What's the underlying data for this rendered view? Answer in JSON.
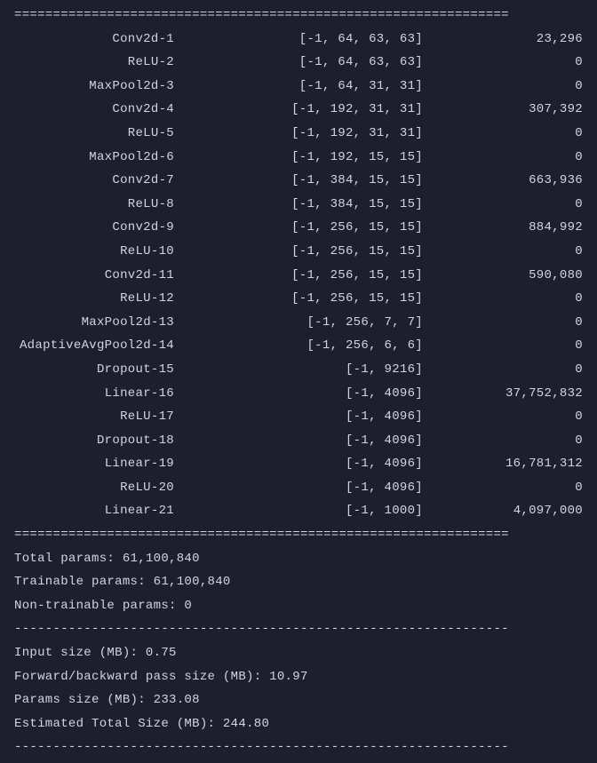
{
  "separator_eq": "================================================================",
  "separator_dash": "----------------------------------------------------------------",
  "layers": [
    {
      "name": "Conv2d-1",
      "shape": "[-1, 64, 63, 63]",
      "params": "23,296"
    },
    {
      "name": "ReLU-2",
      "shape": "[-1, 64, 63, 63]",
      "params": "0"
    },
    {
      "name": "MaxPool2d-3",
      "shape": "[-1, 64, 31, 31]",
      "params": "0"
    },
    {
      "name": "Conv2d-4",
      "shape": "[-1, 192, 31, 31]",
      "params": "307,392"
    },
    {
      "name": "ReLU-5",
      "shape": "[-1, 192, 31, 31]",
      "params": "0"
    },
    {
      "name": "MaxPool2d-6",
      "shape": "[-1, 192, 15, 15]",
      "params": "0"
    },
    {
      "name": "Conv2d-7",
      "shape": "[-1, 384, 15, 15]",
      "params": "663,936"
    },
    {
      "name": "ReLU-8",
      "shape": "[-1, 384, 15, 15]",
      "params": "0"
    },
    {
      "name": "Conv2d-9",
      "shape": "[-1, 256, 15, 15]",
      "params": "884,992"
    },
    {
      "name": "ReLU-10",
      "shape": "[-1, 256, 15, 15]",
      "params": "0"
    },
    {
      "name": "Conv2d-11",
      "shape": "[-1, 256, 15, 15]",
      "params": "590,080"
    },
    {
      "name": "ReLU-12",
      "shape": "[-1, 256, 15, 15]",
      "params": "0"
    },
    {
      "name": "MaxPool2d-13",
      "shape": "[-1, 256, 7, 7]",
      "params": "0"
    },
    {
      "name": "AdaptiveAvgPool2d-14",
      "shape": "[-1, 256, 6, 6]",
      "params": "0"
    },
    {
      "name": "Dropout-15",
      "shape": "[-1, 9216]",
      "params": "0"
    },
    {
      "name": "Linear-16",
      "shape": "[-1, 4096]",
      "params": "37,752,832"
    },
    {
      "name": "ReLU-17",
      "shape": "[-1, 4096]",
      "params": "0"
    },
    {
      "name": "Dropout-18",
      "shape": "[-1, 4096]",
      "params": "0"
    },
    {
      "name": "Linear-19",
      "shape": "[-1, 4096]",
      "params": "16,781,312"
    },
    {
      "name": "ReLU-20",
      "shape": "[-1, 4096]",
      "params": "0"
    },
    {
      "name": "Linear-21",
      "shape": "[-1, 1000]",
      "params": "4,097,000"
    }
  ],
  "summary": {
    "total_params": "Total params: 61,100,840",
    "trainable_params": "Trainable params: 61,100,840",
    "non_trainable_params": "Non-trainable params: 0",
    "input_size": "Input size (MB): 0.75",
    "fb_pass_size": "Forward/backward pass size (MB): 10.97",
    "params_size": "Params size (MB): 233.08",
    "est_total_size": "Estimated Total Size (MB): 244.80"
  }
}
